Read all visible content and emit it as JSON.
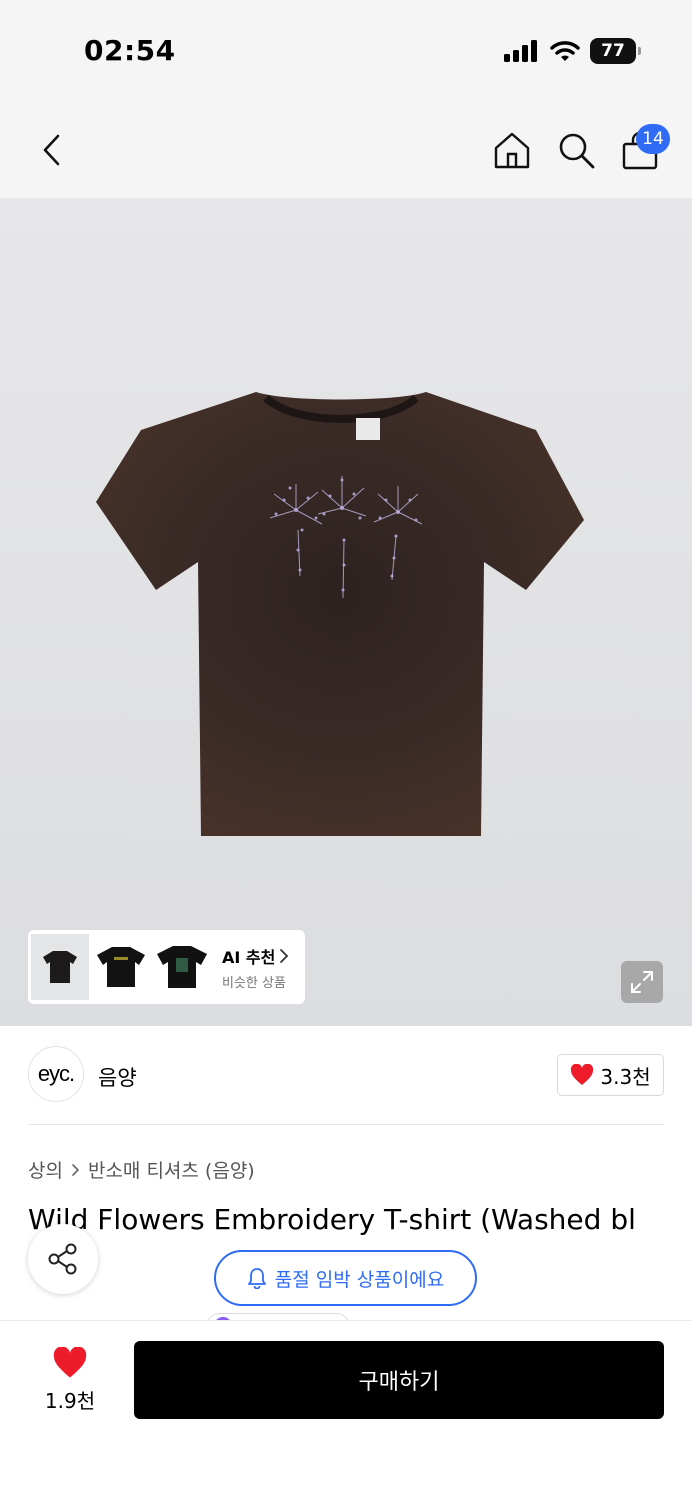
{
  "status_bar": {
    "time": "02:54",
    "battery": "77"
  },
  "nav": {
    "cart_count": "14"
  },
  "gallery": {
    "ai_title": "AI 추천",
    "ai_subtitle": "비슷한 상품"
  },
  "brand": {
    "logo_text": "eyc.",
    "name": "음양",
    "likes": "3.3천"
  },
  "breadcrumb": {
    "category": "상의",
    "subcategory": "반소매 티셔츠 (음양)"
  },
  "product": {
    "title": "Wild Flowers Embroidery T-shirt (Washed bl"
  },
  "notice": {
    "soldout_label": "품절 임박 상품이에요"
  },
  "bottom_bar": {
    "wish_count": "1.9천",
    "buy_label": "구매하기"
  },
  "colors": {
    "accent_blue": "#2f6bf5",
    "heart_red": "#ee1c2a",
    "buy_button": "#000000",
    "shirt": "#3a2a26"
  },
  "icons": [
    "back-icon",
    "home-icon",
    "search-icon",
    "shopping-bag-icon",
    "expand-icon",
    "heart-icon",
    "share-icon",
    "bell-icon",
    "chevron-right-icon"
  ]
}
